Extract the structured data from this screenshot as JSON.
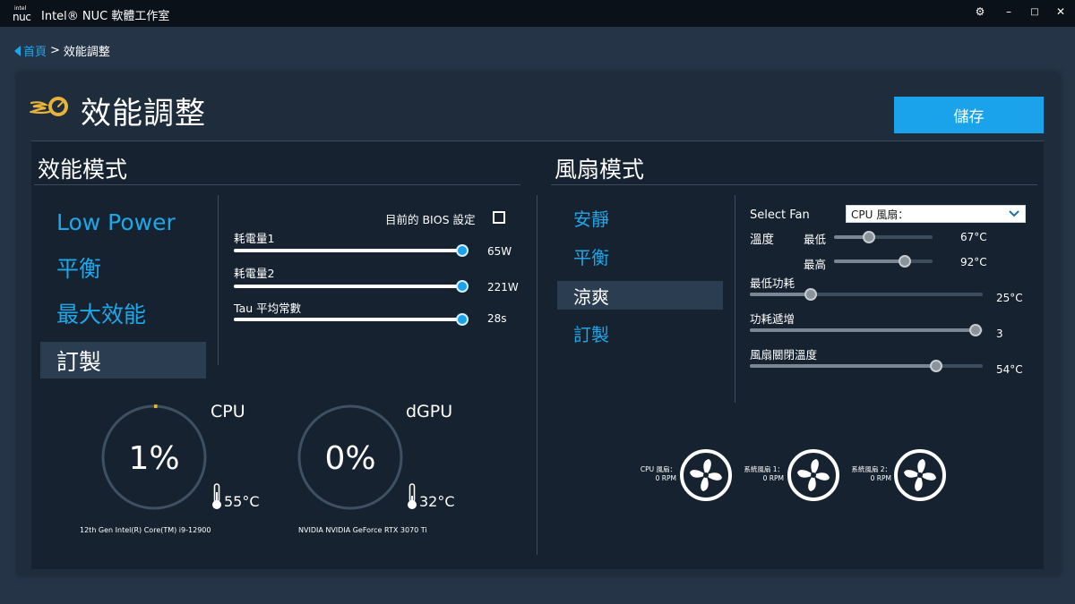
{
  "window": {
    "logo_top": "intel",
    "logo_bottom": "nuc",
    "title": "Intel® NUC 軟體工作室"
  },
  "breadcrumb": {
    "home": "首頁",
    "separator": ">",
    "current": "效能調整"
  },
  "header": {
    "title": "效能調整",
    "save_label": "儲存"
  },
  "perf_section": {
    "title": "效能模式",
    "modes": [
      {
        "label": "Low Power",
        "selected": false
      },
      {
        "label": "平衡",
        "selected": false
      },
      {
        "label": "最大效能",
        "selected": false
      },
      {
        "label": "訂製",
        "selected": true
      }
    ],
    "bios_label": "目前的 BIOS 設定",
    "sliders": [
      {
        "label": "耗電量1",
        "value_text": "65W",
        "level": 1.0
      },
      {
        "label": "耗電量2",
        "value_text": "221W",
        "level": 1.0
      },
      {
        "label": "Tau 平均常數",
        "value_text": "28s",
        "level": 1.0
      }
    ]
  },
  "gauges": [
    {
      "title": "CPU",
      "percent_text": "1%",
      "level": 0.01,
      "temp": "55°C",
      "device": "12th Gen Intel(R) Core(TM) i9-12900"
    },
    {
      "title": "dGPU",
      "percent_text": "0%",
      "level": 0.0,
      "temp": "32°C",
      "device": "NVIDIA NVIDIA GeForce RTX 3070 Ti"
    }
  ],
  "fan_section": {
    "title": "風扇模式",
    "modes": [
      {
        "label": "安靜",
        "selected": false
      },
      {
        "label": "平衡",
        "selected": false
      },
      {
        "label": "涼爽",
        "selected": true
      },
      {
        "label": "訂製",
        "selected": false
      }
    ],
    "select_fan_label": "Select Fan",
    "select_fan_value": "CPU 風扇：",
    "temp_label": "溫度",
    "temp_min_label": "最低",
    "temp_min_value": "67°C",
    "temp_min_level": 0.35,
    "temp_max_label": "最高",
    "temp_max_value": "92°C",
    "temp_max_level": 0.72,
    "min_power_label": "最低功耗",
    "min_power_value": "25°C",
    "min_power_level": 0.26,
    "ramp_label": "功耗遞增",
    "ramp_value": "3",
    "ramp_level": 0.97,
    "off_temp_label": "風扇關閉溫度",
    "off_temp_value": "54°C",
    "off_temp_level": 0.8,
    "fans": [
      {
        "name": "CPU 風扇：",
        "rpm": "0 RPM"
      },
      {
        "name": "系統風扇 1：",
        "rpm": "0 RPM"
      },
      {
        "name": "系統風扇 2：",
        "rpm": "0 RPM"
      }
    ]
  },
  "colors": {
    "accent": "#1aa3ea",
    "background": "#253447",
    "panel": "#1e2c3c",
    "inner": "#16222f",
    "titlebar": "#0b1118",
    "selected_item": "#2b3d51",
    "gauge_ring": "#3e5062",
    "gauge_marker": "#e8b33a"
  }
}
